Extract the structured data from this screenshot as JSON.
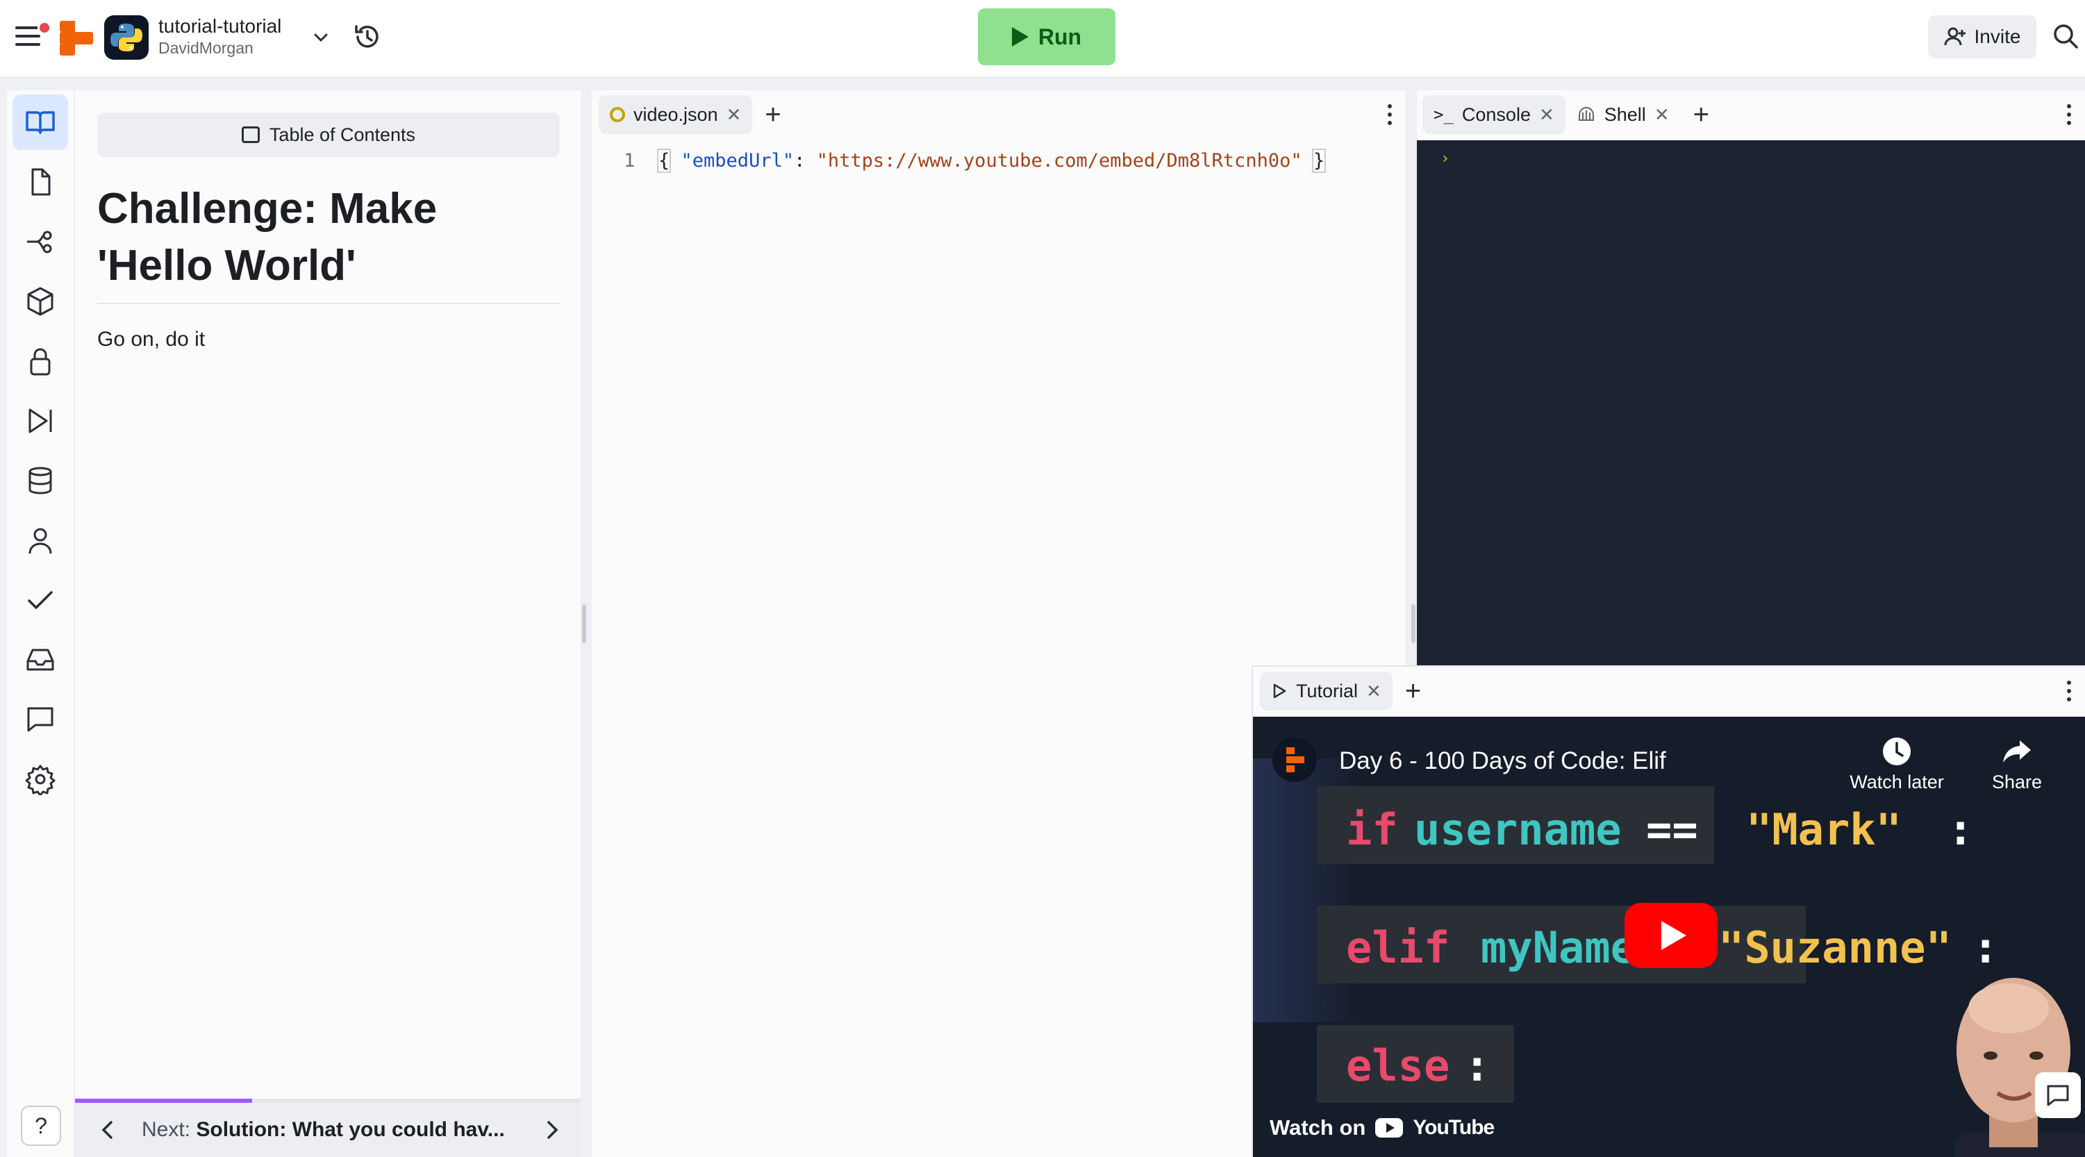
{
  "topbar": {
    "repo_name": "tutorial-tutorial",
    "repo_owner": "DavidMorgan",
    "run_label": "Run",
    "invite_label": "Invite"
  },
  "tutorial": {
    "toc_label": "Table of Contents",
    "title": "Challenge: Make 'Hello World'",
    "body": "Go on, do it",
    "progress_fraction": 0.35,
    "next_prefix": "Next:",
    "next_title": "Solution: What you could hav...",
    "help_label": "?"
  },
  "editor": {
    "tab_label": "video.json",
    "line_number": "1",
    "code": {
      "open": "{",
      "key": "\"embedUrl\"",
      "colon": ": ",
      "value": "\"https://www.youtube.com/embed/Dm8lRtcnh0o\"",
      "close": "}"
    }
  },
  "console_pane": {
    "tabs": [
      {
        "label": "Console"
      },
      {
        "label": "Shell"
      }
    ],
    "prompt": "›"
  },
  "video_pane": {
    "tab_label": "Tutorial",
    "video_title": "Day 6 - 100 Days of Code: Elif",
    "watch_later": "Watch later",
    "share": "Share",
    "watch_on": "Watch on",
    "youtube": "YouTube",
    "code_lines": {
      "l1_kw": "if",
      "l1_var": "username",
      "l1_op": "==",
      "l1_str": "\"Mark\"",
      "l1_colon": ":",
      "l2_kw": "elif",
      "l2_var": "myName",
      "l2_str": "\"Suzanne\"",
      "l2_colon": ":",
      "l3_kw": "else",
      "l3_colon": ":"
    }
  },
  "colors": {
    "run_bg": "#8fe08f",
    "accent_purple": "#a259ff",
    "console_bg": "#1c2333",
    "brand_orange": "#f26207",
    "youtube_red": "#ff0000"
  }
}
